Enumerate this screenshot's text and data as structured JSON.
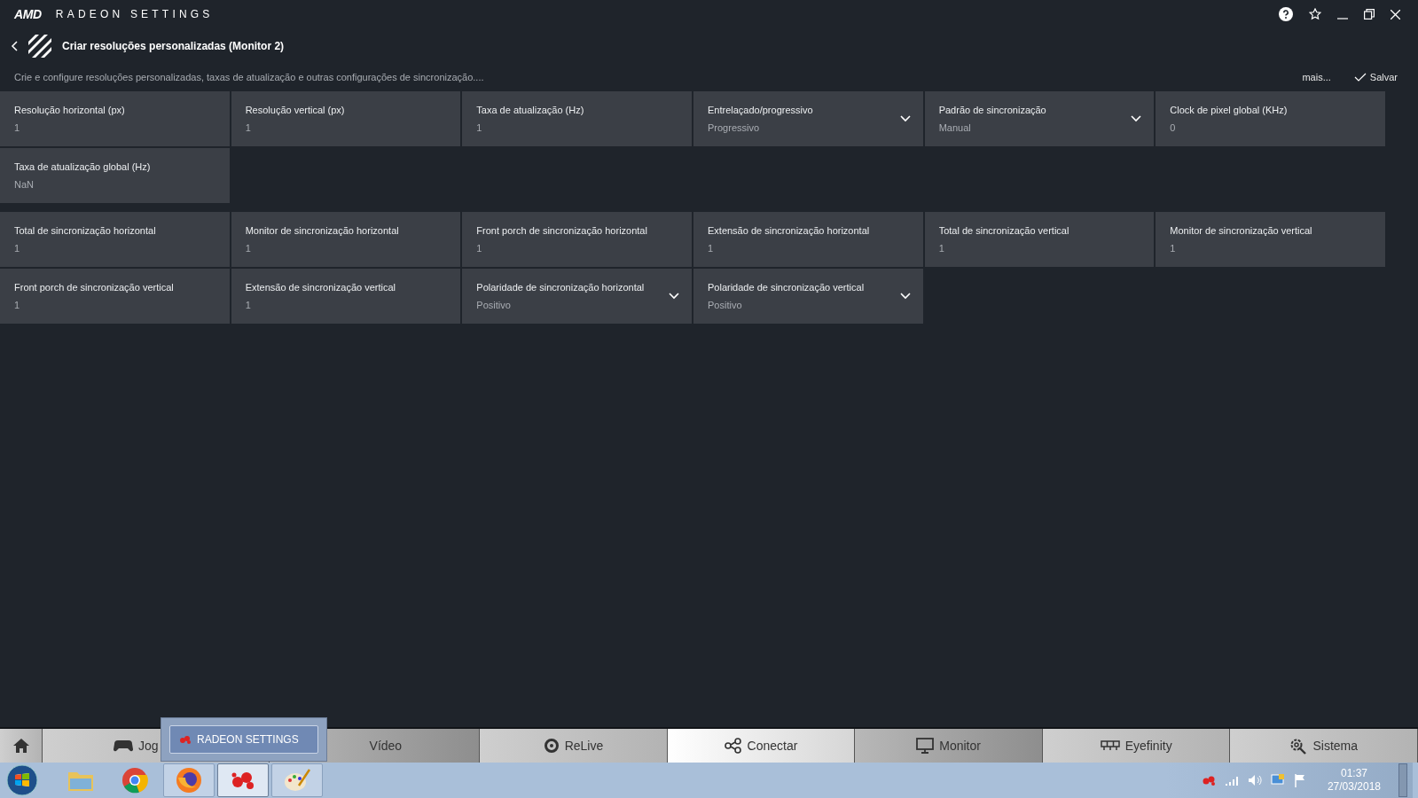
{
  "app": {
    "brand": "AMD",
    "title": "RADEON SETTINGS"
  },
  "page": {
    "title": "Criar resoluções personalizadas (Monitor 2)",
    "description": "Crie e configure resoluções personalizadas, taxas de atualização e outras configurações de sincronização....",
    "more": "mais...",
    "save": "Salvar"
  },
  "groups": [
    [
      {
        "kind": "input",
        "label": "Resolução horizontal (px)",
        "value": "1"
      },
      {
        "kind": "input",
        "label": "Resolução vertical (px)",
        "value": "1"
      },
      {
        "kind": "input",
        "label": "Taxa de atualização (Hz)",
        "value": "1"
      },
      {
        "kind": "dropdown",
        "label": "Entrelaçado/progressivo",
        "value": "Progressivo"
      },
      {
        "kind": "dropdown",
        "label": "Padrão de sincronização",
        "value": "Manual"
      },
      {
        "kind": "input",
        "label": "Clock de pixel global (KHz)",
        "value": "0"
      },
      {
        "kind": "input",
        "label": "Taxa de atualização global (Hz)",
        "value": "NaN"
      }
    ],
    [
      {
        "kind": "input",
        "label": "Total de sincronização horizontal",
        "value": "1"
      },
      {
        "kind": "input",
        "label": "Monitor de sincronização horizontal",
        "value": "1"
      },
      {
        "kind": "input",
        "label": "Front porch de sincronização horizontal",
        "value": "1"
      },
      {
        "kind": "input",
        "label": "Extensão de sincronização horizontal",
        "value": "1"
      },
      {
        "kind": "input",
        "label": "Total de sincronização vertical",
        "value": "1"
      },
      {
        "kind": "input",
        "label": "Monitor de sincronização vertical",
        "value": "1"
      },
      {
        "kind": "input",
        "label": "Front porch de sincronização vertical",
        "value": "1"
      },
      {
        "kind": "input",
        "label": "Extensão de sincronização vertical",
        "value": "1"
      },
      {
        "kind": "dropdown",
        "label": "Polaridade de sincronização horizontal",
        "value": "Positivo"
      },
      {
        "kind": "dropdown",
        "label": "Polaridade de sincronização vertical",
        "value": "Positivo"
      }
    ]
  ],
  "nav": [
    {
      "kind": "home",
      "selected": false,
      "hovered": false
    },
    {
      "kind": "games",
      "label": "Jog",
      "selected": false,
      "hovered": false
    },
    {
      "kind": "video",
      "label": "Vídeo",
      "selected": false,
      "hovered": true
    },
    {
      "kind": "relive",
      "label": "ReLive",
      "selected": false,
      "hovered": false
    },
    {
      "kind": "connect",
      "label": "Conectar",
      "selected": true,
      "hovered": false
    },
    {
      "kind": "monitor",
      "label": "Monitor",
      "selected": false,
      "hovered": true
    },
    {
      "kind": "eyefinity",
      "label": "Eyefinity",
      "selected": false,
      "hovered": false
    },
    {
      "kind": "system",
      "label": "Sistema",
      "selected": false,
      "hovered": false
    }
  ],
  "taskbar_popup": {
    "label": "RADEON SETTINGS"
  },
  "taskbar": {
    "apps": [
      {
        "kind": "folder",
        "running": false,
        "selected": false
      },
      {
        "kind": "chrome",
        "running": false,
        "selected": false
      },
      {
        "kind": "firefox",
        "running": true,
        "selected": false
      },
      {
        "kind": "radeon",
        "running": true,
        "selected": true
      },
      {
        "kind": "paint",
        "running": true,
        "selected": false
      }
    ],
    "time": "01:37",
    "date": "27/03/2018"
  }
}
